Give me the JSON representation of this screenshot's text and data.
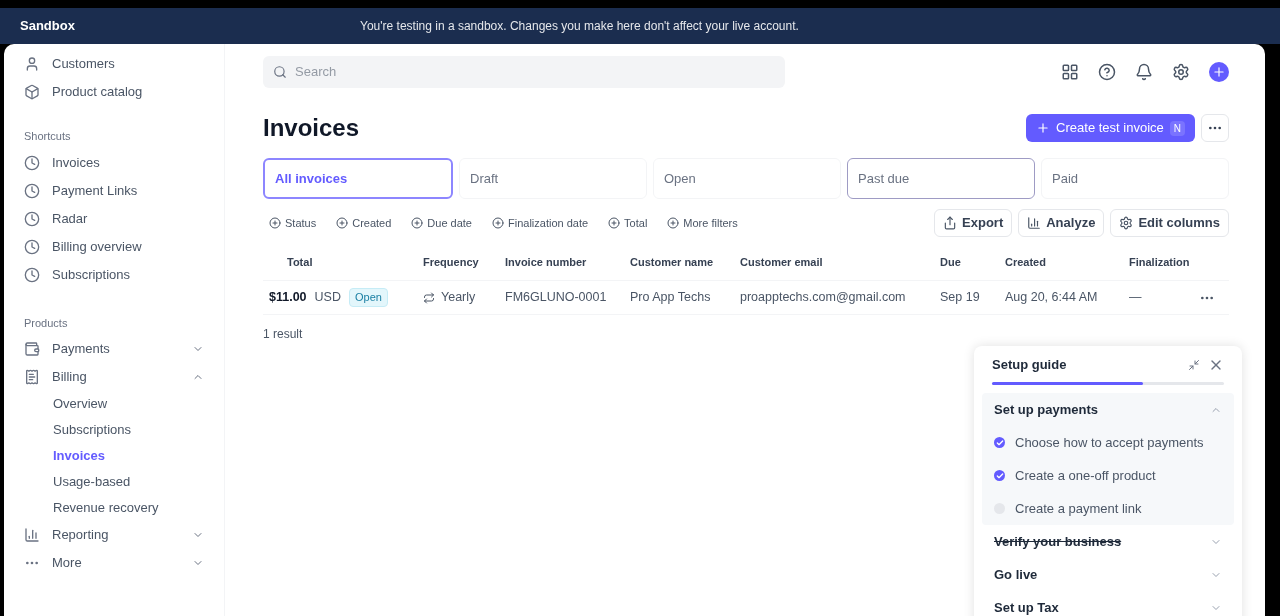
{
  "banner": {
    "title": "Sandbox",
    "message": "You're testing in a sandbox. Changes you make here don't affect your live account."
  },
  "sidebar": {
    "top_items": [
      {
        "label": "Customers"
      },
      {
        "label": "Product catalog"
      }
    ],
    "shortcuts_heading": "Shortcuts",
    "shortcuts": [
      "Invoices",
      "Payment Links",
      "Radar",
      "Billing overview",
      "Subscriptions"
    ],
    "products_heading": "Products",
    "products": [
      {
        "label": "Payments",
        "expanded": false
      },
      {
        "label": "Billing",
        "expanded": true,
        "children": [
          {
            "label": "Overview",
            "selected": false
          },
          {
            "label": "Subscriptions",
            "selected": false
          },
          {
            "label": "Invoices",
            "selected": true
          },
          {
            "label": "Usage-based",
            "selected": false
          },
          {
            "label": "Revenue recovery",
            "selected": false
          }
        ]
      },
      {
        "label": "Reporting",
        "expanded": false
      },
      {
        "label": "More",
        "expanded": false
      }
    ]
  },
  "search": {
    "placeholder": "Search"
  },
  "page": {
    "title": "Invoices",
    "create_button": "Create test invoice",
    "create_shortcut": "N"
  },
  "tabs": [
    {
      "label": "All invoices",
      "selected": true,
      "hovered": false
    },
    {
      "label": "Draft",
      "selected": false,
      "hovered": false
    },
    {
      "label": "Open",
      "selected": false,
      "hovered": false
    },
    {
      "label": "Past due",
      "selected": false,
      "hovered": true
    },
    {
      "label": "Paid",
      "selected": false,
      "hovered": false
    }
  ],
  "filters": [
    "Status",
    "Created",
    "Due date",
    "Finalization date",
    "Total",
    "More filters"
  ],
  "actions": [
    "Export",
    "Analyze",
    "Edit columns"
  ],
  "table": {
    "columns": [
      "Total",
      "Frequency",
      "Invoice number",
      "Customer name",
      "Customer email",
      "Due",
      "Created",
      "Finalization"
    ],
    "rows": [
      {
        "amount": "$11.00",
        "currency": "USD",
        "status": "Open",
        "frequency": "Yearly",
        "invoice_number": "FM6GLUNO-0001",
        "customer_name": "Pro App Techs",
        "customer_email": "proapptechs.com@gmail.com",
        "due": "Sep 19",
        "created": "Aug 20, 6:44 AM",
        "finalization": "—"
      }
    ]
  },
  "result_count": "1 result",
  "setup_guide": {
    "title": "Setup guide",
    "level": 0.65,
    "sections": [
      {
        "title": "Set up payments",
        "expanded": true,
        "done": false,
        "steps": [
          {
            "label": "Choose how to accept payments",
            "checked": true
          },
          {
            "label": "Create a one-off product",
            "checked": true
          },
          {
            "label": "Create a payment link",
            "checked": false
          }
        ]
      },
      {
        "title": "Verify your business",
        "expanded": false,
        "done": true
      },
      {
        "title": "Go live",
        "expanded": false,
        "done": false
      },
      {
        "title": "Set up Tax",
        "expanded": false,
        "done": false
      }
    ]
  }
}
